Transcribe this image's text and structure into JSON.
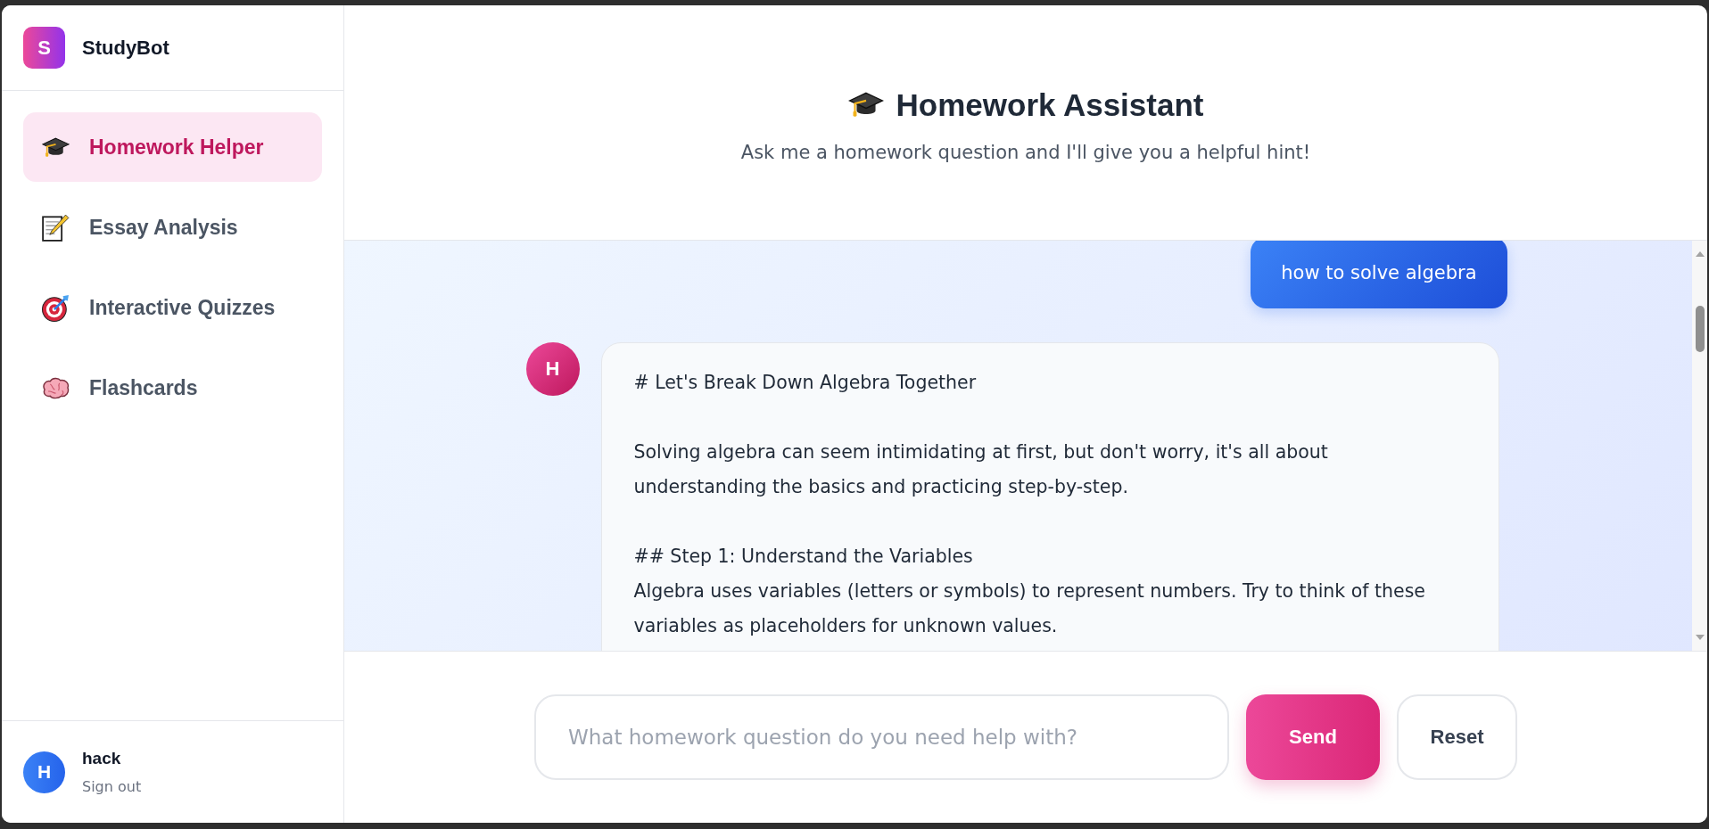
{
  "app": {
    "logo_letter": "S",
    "name": "StudyBot"
  },
  "sidebar": {
    "items": [
      {
        "label": "Homework Helper",
        "selected": true
      },
      {
        "label": "Essay Analysis",
        "selected": false
      },
      {
        "label": "Interactive Quizzes",
        "selected": false
      },
      {
        "label": "Flashcards",
        "selected": false
      }
    ],
    "user": {
      "avatar_letter": "H",
      "name": "hack",
      "sign_out": "Sign out"
    }
  },
  "header": {
    "title": "Homework Assistant",
    "subtitle": "Ask me a homework question and I'll give you a helpful hint!"
  },
  "chat": {
    "messages": [
      {
        "kind": "user",
        "text": "how to solve algebra"
      },
      {
        "kind": "assistant",
        "avatar_letter": "H",
        "paragraphs": [
          [
            "# Let's Break Down Algebra Together"
          ],
          [
            "Solving algebra can seem intimidating at first, but don't worry, it's all about understanding the basics and practicing step-by-step."
          ],
          [
            "## Step 1: Understand the Variables",
            "Algebra uses variables (letters or symbols) to represent numbers. Try to think of these variables as placeholders for unknown values."
          ]
        ]
      }
    ]
  },
  "composer": {
    "placeholder": "What homework question do you need help with?",
    "send": "Send",
    "reset": "Reset"
  }
}
